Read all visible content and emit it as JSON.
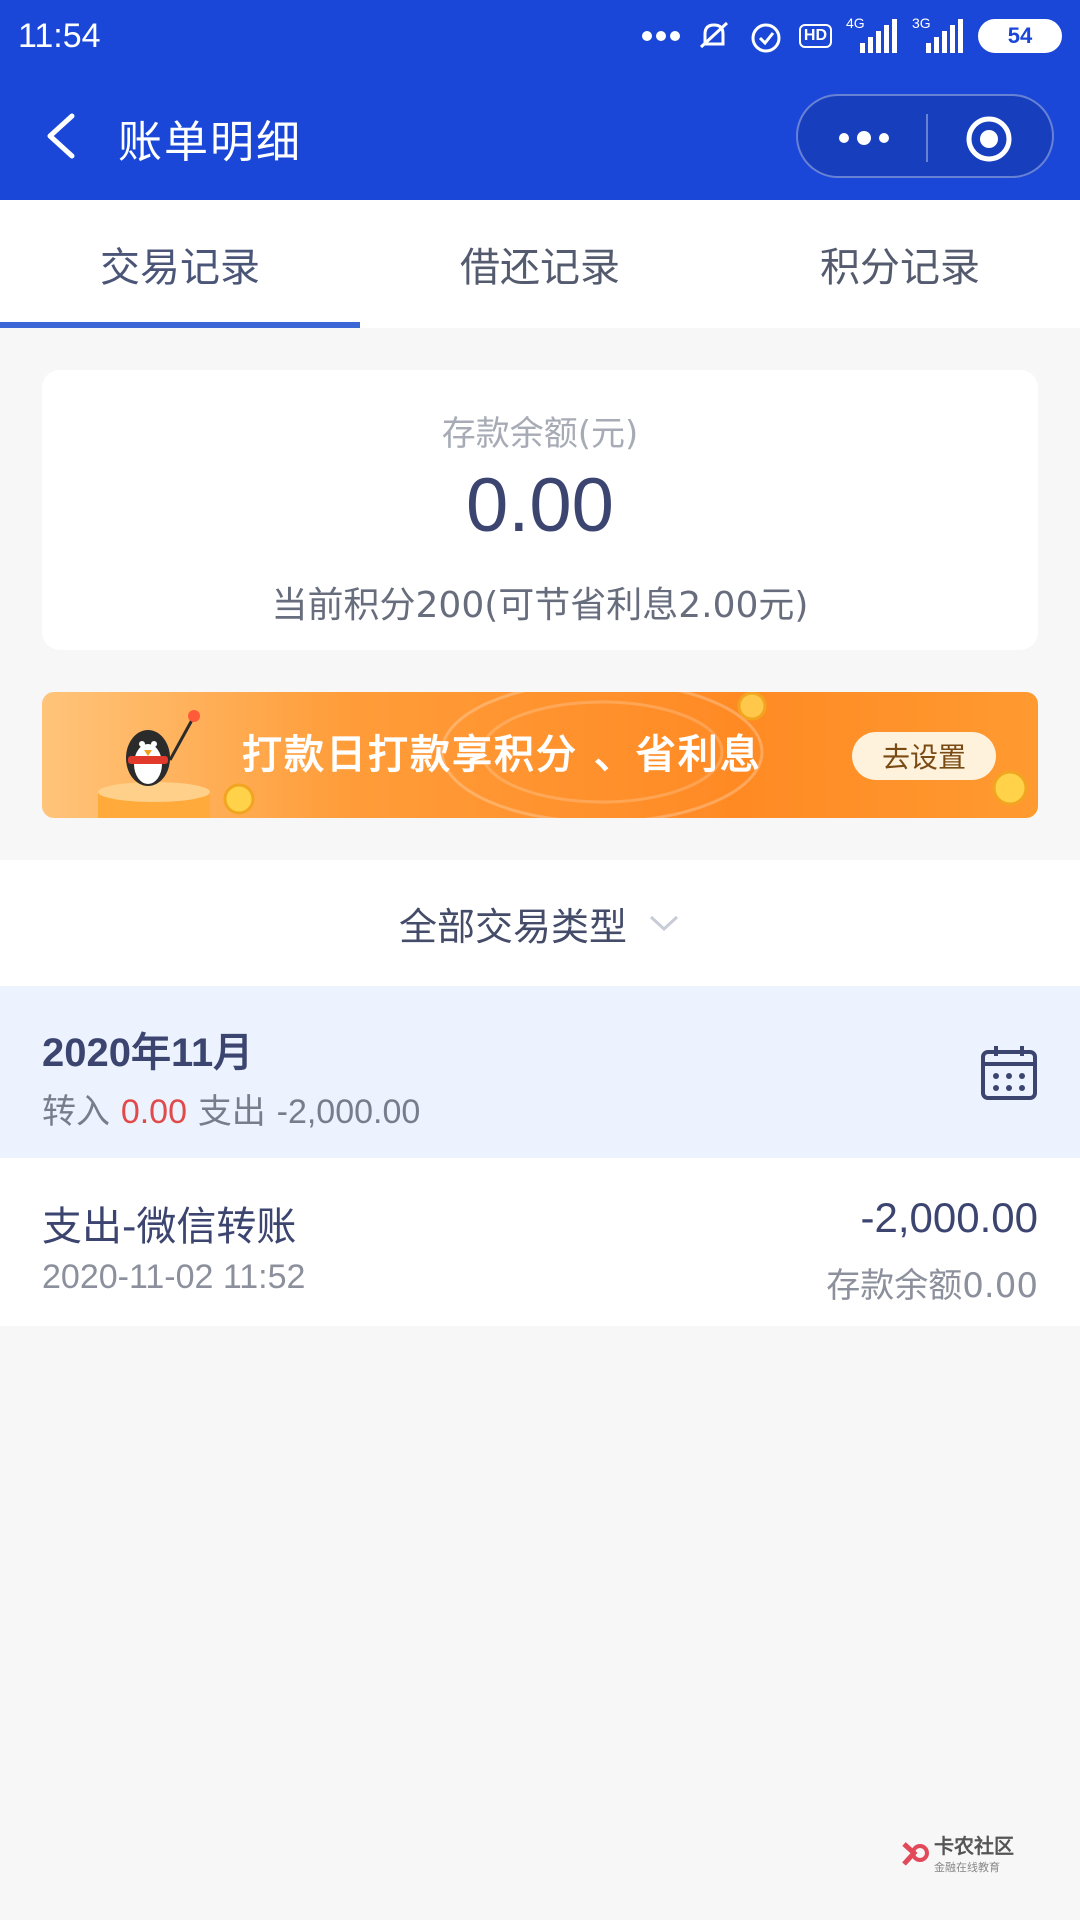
{
  "status_bar": {
    "time": "11:54",
    "network1": "4G",
    "network2": "3G",
    "hd": "HD",
    "battery": "54"
  },
  "nav": {
    "title": "账单明细",
    "brand_color": "#1a47d8"
  },
  "tabs": [
    {
      "label": "交易记录",
      "active": true
    },
    {
      "label": "借还记录",
      "active": false
    },
    {
      "label": "积分记录",
      "active": false
    }
  ],
  "balance": {
    "label": "存款余额(元)",
    "value": "0.00",
    "points_text": "当前积分200(可节省利息2.00元)"
  },
  "banner": {
    "text": "打款日打款享积分 、省利息",
    "button": "去设置"
  },
  "filter": {
    "label": "全部交易类型"
  },
  "month": {
    "title": "2020年11月",
    "in_label": "转入",
    "in_value": "0.00",
    "out_label": "支出",
    "out_value": "-2,000.00"
  },
  "transactions": [
    {
      "title": "支出-微信转账",
      "datetime": "2020-11-02 11:52",
      "amount": "-2,000.00",
      "balance_text": "存款余额0.00"
    }
  ],
  "watermark": {
    "main": "卡农社区",
    "sub": "金融在线教育"
  }
}
